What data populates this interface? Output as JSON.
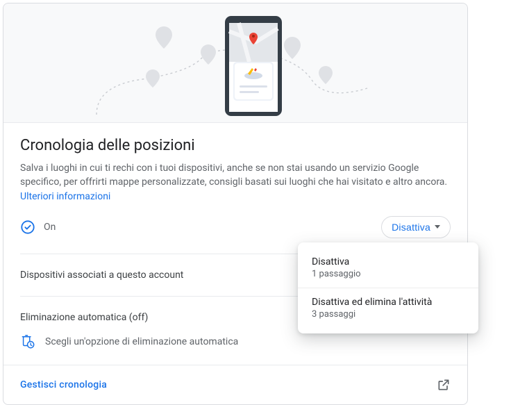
{
  "title": "Cronologia delle posizioni",
  "description_lead": "Salva i luoghi in cui ti rechi con i tuoi dispositivi, anche se non stai usando un servizio Google specifico, per offrirti mappe personalizzate, consigli basati sui luoghi che hai visitato e altro ancora. ",
  "more_info_link": "Ulteriori informazioni",
  "status": {
    "state": "On",
    "button_label": "Disattiva"
  },
  "dropdown": {
    "items": [
      {
        "title": "Disattiva",
        "subtitle": "1 passaggio"
      },
      {
        "title": "Disattiva ed elimina l'attività",
        "subtitle": "3 passaggi"
      }
    ]
  },
  "devices_section_title": "Dispositivi associati a questo account",
  "auto_delete": {
    "title": "Eliminazione automatica (off)",
    "option_label": "Scegli un'opzione di eliminazione automatica"
  },
  "footer_link": "Gestisci cronologia"
}
